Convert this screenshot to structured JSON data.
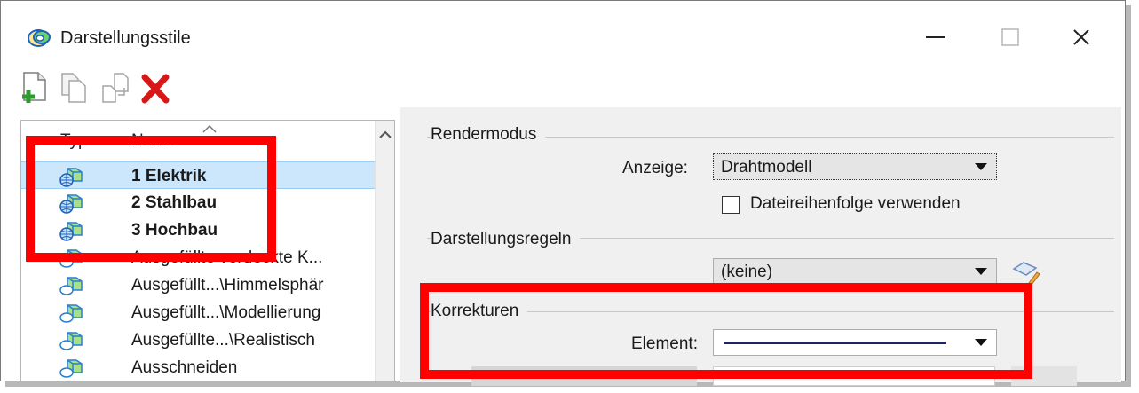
{
  "window": {
    "title": "Darstellungsstile",
    "minimize_label": "—",
    "close_label": "✕"
  },
  "toolbar": {
    "icons": [
      "new-style-icon",
      "copy-style-icon",
      "import-style-icon",
      "delete-icon"
    ]
  },
  "list": {
    "columns": {
      "type": "Typ",
      "name": "Name"
    },
    "items": [
      {
        "label": "1 Elektrik",
        "bold": true,
        "icon": "style-global-icon",
        "selected": true
      },
      {
        "label": "2 Stahlbau",
        "bold": true,
        "icon": "style-global-icon",
        "selected": false
      },
      {
        "label": "3 Hochbau",
        "bold": true,
        "icon": "style-global-icon",
        "selected": false
      },
      {
        "label": "Ausgefüllte verdeckte K...",
        "bold": false,
        "icon": "style-icon",
        "selected": false
      },
      {
        "label": "Ausgefüllt...\\Himmelsphär",
        "bold": false,
        "icon": "style-icon",
        "selected": false
      },
      {
        "label": "Ausgefüllt...\\Modellierung",
        "bold": false,
        "icon": "style-icon",
        "selected": false
      },
      {
        "label": "Ausgefüllte...\\Realistisch",
        "bold": false,
        "icon": "style-icon",
        "selected": false
      },
      {
        "label": "Ausschneiden",
        "bold": false,
        "icon": "style-icon",
        "selected": false
      }
    ]
  },
  "render": {
    "group_title": "Rendermodus",
    "display_label": "Anzeige:",
    "display_value": "Drahtmodell",
    "file_order_label": "Dateireihenfolge verwenden"
  },
  "rules": {
    "group_title": "Darstellungsregeln",
    "value": "(keine)"
  },
  "corrections": {
    "group_title": "Korrekturen",
    "element_label": "Element:"
  },
  "colors": {
    "annotation_red": "#ff0000",
    "selection": "#cce6fb"
  }
}
